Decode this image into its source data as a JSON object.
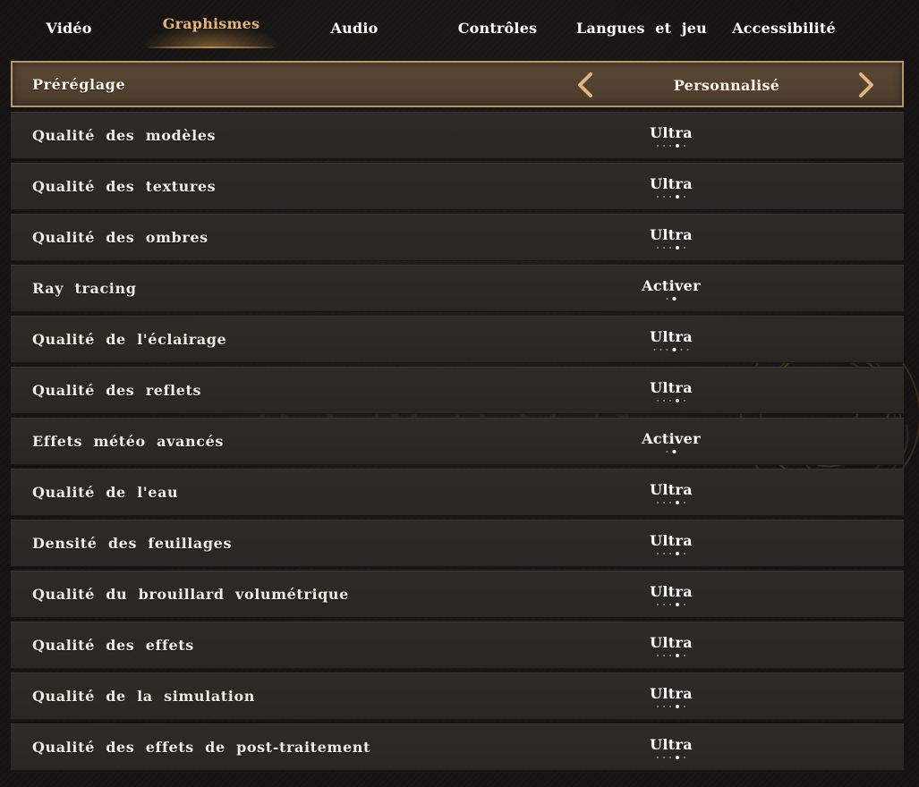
{
  "tabs": [
    {
      "label": "Vidéo",
      "active": false
    },
    {
      "label": "Graphismes",
      "active": true
    },
    {
      "label": "Audio",
      "active": false
    },
    {
      "label": "Contrôles",
      "active": false
    },
    {
      "label": "Langues  et  jeu",
      "active": false
    },
    {
      "label": "Accessibilité",
      "active": false
    }
  ],
  "preset": {
    "label": "Préréglage",
    "value": "Personnalisé"
  },
  "settings": [
    {
      "label": "Qualité  des  modèles",
      "value": "Ultra",
      "dots": 5,
      "selected": 4
    },
    {
      "label": "Qualité  des  textures",
      "value": "Ultra",
      "dots": 5,
      "selected": 4
    },
    {
      "label": "Qualité  des  ombres",
      "value": "Ultra",
      "dots": 5,
      "selected": 4
    },
    {
      "label": "Ray  tracing",
      "value": "Activer",
      "dots": 2,
      "selected": 2
    },
    {
      "label": "Qualité  de  l'éclairage",
      "value": "Ultra",
      "dots": 6,
      "selected": 4
    },
    {
      "label": "Qualité  des  reflets",
      "value": "Ultra",
      "dots": 5,
      "selected": 4
    },
    {
      "label": "Effets  météo  avancés",
      "value": "Activer",
      "dots": 2,
      "selected": 2
    },
    {
      "label": "Qualité  de  l'eau",
      "value": "Ultra",
      "dots": 5,
      "selected": 4
    },
    {
      "label": "Densité  des  feuillages",
      "value": "Ultra",
      "dots": 5,
      "selected": 4
    },
    {
      "label": "Qualité  du  brouillard  volumétrique",
      "value": "Ultra",
      "dots": 5,
      "selected": 4
    },
    {
      "label": "Qualité  des  effets",
      "value": "Ultra",
      "dots": 5,
      "selected": 4
    },
    {
      "label": "Qualité  de  la  simulation",
      "value": "Ultra",
      "dots": 5,
      "selected": 4
    },
    {
      "label": "Qualité  des  effets  de  post-traitement",
      "value": "Ultra",
      "dots": 5,
      "selected": 4
    }
  ],
  "watermark": "RIMSON",
  "colors": {
    "accent": "#e6b277",
    "preset_border": "#b7966a",
    "row_bg": "#2c2925",
    "background": "#141311"
  }
}
